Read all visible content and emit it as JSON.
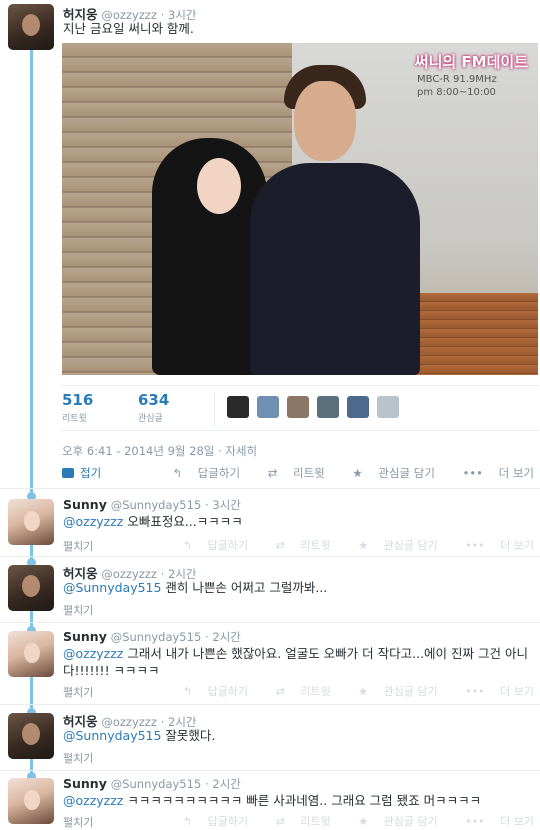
{
  "main_tweet": {
    "name": "허지웅",
    "handle": "@ozzyzzz",
    "time": "· 3시간",
    "text": "지난 금요일 써니와 함께.",
    "photo": {
      "logo_title": "써니의 FM데이트",
      "logo_freq": "MBC-R 91.9MHz",
      "logo_hours": "pm 8:00~10:00"
    },
    "retweets_count": "516",
    "retweets_label": "리트윗",
    "favorites_count": "634",
    "favorites_label": "관심글",
    "timestamp": "오후 6:41 - 2014년 9월 28일 · 자세히",
    "fold_label": "접기",
    "actions": {
      "reply": "답글하기",
      "retweet": "리트윗",
      "favorite": "관심글 담기",
      "more": "더 보기"
    }
  },
  "replies": [
    {
      "name": "Sunny",
      "handle": "@Sunnyday515",
      "time": "· 3시간",
      "mention": "@ozzyzzz",
      "text": " 오빠표정요...ㅋㅋㅋㅋ",
      "expand": "펼치기",
      "avatar": "female"
    },
    {
      "name": "허지웅",
      "handle": "@ozzyzzz",
      "time": "· 2시간",
      "mention": "@Sunnyday515",
      "text": " 괜히 나쁜손 어쩌고 그럴까봐...",
      "expand": "펼치기",
      "avatar": "male"
    },
    {
      "name": "Sunny",
      "handle": "@Sunnyday515",
      "time": "· 2시간",
      "mention": "@ozzyzzz",
      "text": " 그래서 내가 나쁜손 했잖아요. 얼굴도 오빠가 더 작다고...에이 진짜 그건 아니다!!!!!!! ㅋㅋㅋㅋ",
      "expand": "펼치기",
      "avatar": "female"
    },
    {
      "name": "허지웅",
      "handle": "@ozzyzzz",
      "time": "· 2시간",
      "mention": "@Sunnyday515",
      "text": " 잘못했다.",
      "expand": "펼치기",
      "avatar": "male"
    },
    {
      "name": "Sunny",
      "handle": "@Sunnyday515",
      "time": "· 2시간",
      "mention": "@ozzyzzz",
      "text": " ㅋㅋㅋㅋㅋㅋㅋㅋㅋㅋ 빠른 사과네염.. 그래요 그럼 됐죠 머ㅋㅋㅋㅋ",
      "expand": "펼치기",
      "avatar": "female"
    }
  ],
  "reply_actions": {
    "reply": "답글하기",
    "retweet": "리트윗",
    "favorite": "관심글 담기",
    "more": "더 보기"
  },
  "icons": {
    "reply": "reply-icon",
    "retweet": "retweet-icon",
    "favorite": "star-icon",
    "more": "more-icon",
    "fold": "fold-icon"
  },
  "colors": {
    "thread_line": "#7fc4e6",
    "link": "#2b7bb9",
    "muted": "#8899a6",
    "faded": "#d4dbe0"
  }
}
